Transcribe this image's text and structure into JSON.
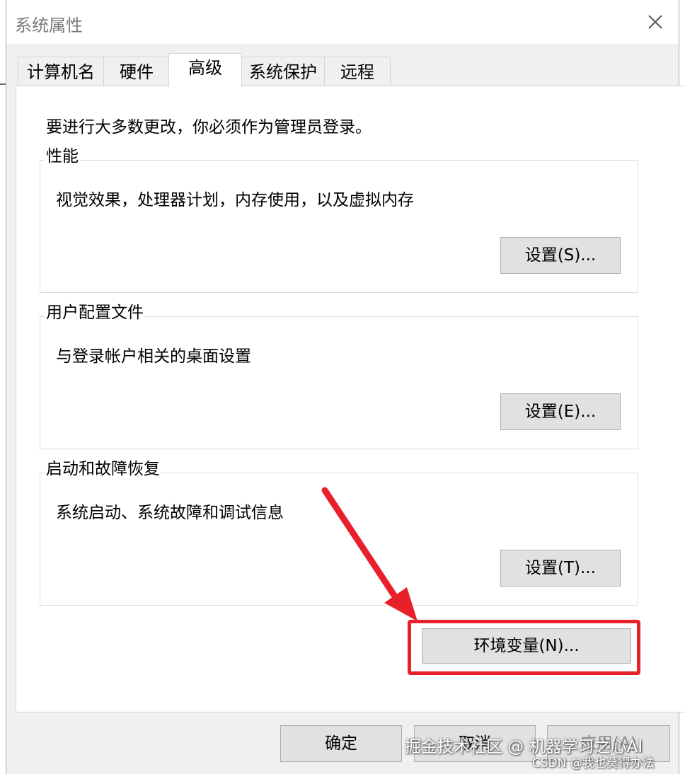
{
  "window": {
    "title": "系统属性"
  },
  "tabs": [
    {
      "label": "计算机名",
      "active": false
    },
    {
      "label": "硬件",
      "active": false
    },
    {
      "label": "高级",
      "active": true
    },
    {
      "label": "系统保护",
      "active": false
    },
    {
      "label": "远程",
      "active": false
    }
  ],
  "advanced": {
    "admin_note": "要进行大多数更改，你必须作为管理员登录。",
    "groups": [
      {
        "title": "性能",
        "description": "视觉效果，处理器计划，内存使用，以及虚拟内存",
        "button": "设置(S)..."
      },
      {
        "title": "用户配置文件",
        "description": "与登录帐户相关的桌面设置",
        "button": "设置(E)..."
      },
      {
        "title": "启动和故障恢复",
        "description": "系统启动、系统故障和调试信息",
        "button": "设置(T)..."
      }
    ],
    "env_button": "环境变量(N)..."
  },
  "footer": {
    "ok": "确定",
    "cancel": "取消",
    "apply": "应用(A)"
  },
  "annotation": {
    "highlight_color": "#e8202a"
  },
  "watermark": {
    "line1": "掘金技术社区 @ 机器学习之心AI",
    "line2": "CSDN @我也莫得办法"
  },
  "colors": {
    "dialog_bg": "#f0f0f0",
    "panel_bg": "#ffffff",
    "button_bg": "#e1e1e1",
    "button_border": "#adadad",
    "title_text": "#7a7a7a"
  }
}
